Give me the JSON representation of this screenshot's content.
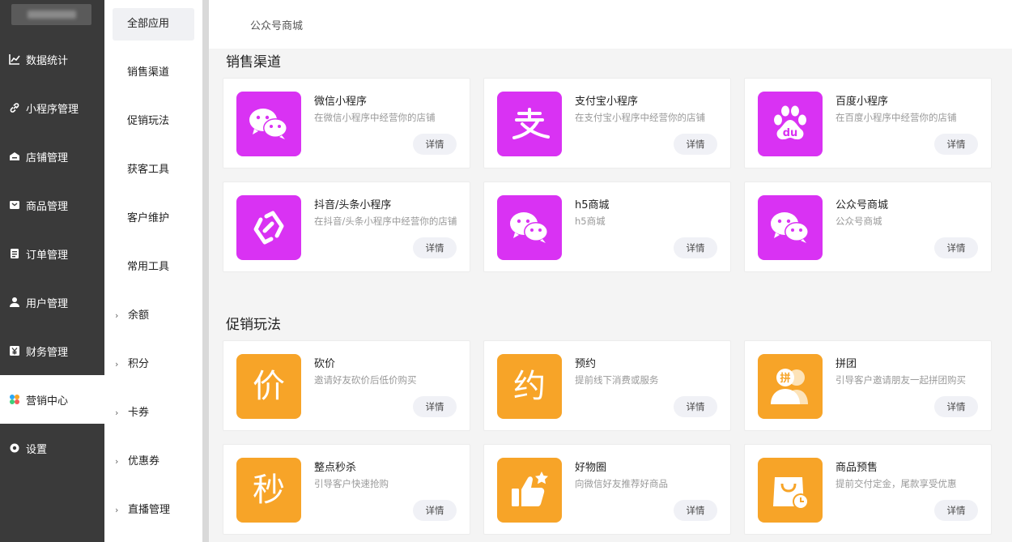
{
  "sidebar": {
    "items": [
      {
        "label": "数据统计",
        "icon": "chart-line-icon"
      },
      {
        "label": "小程序管理",
        "icon": "link-icon"
      },
      {
        "label": "店铺管理",
        "icon": "store-icon"
      },
      {
        "label": "商品管理",
        "icon": "box-icon"
      },
      {
        "label": "订单管理",
        "icon": "clipboard-icon"
      },
      {
        "label": "用户管理",
        "icon": "user-icon"
      },
      {
        "label": "财务管理",
        "icon": "yen-icon"
      },
      {
        "label": "营销中心",
        "icon": "marketing-icon"
      },
      {
        "label": "设置",
        "icon": "gear-icon"
      }
    ]
  },
  "submenu": {
    "items": [
      {
        "label": "全部应用"
      },
      {
        "label": "销售渠道"
      },
      {
        "label": "促销玩法"
      },
      {
        "label": "获客工具"
      },
      {
        "label": "客户维护"
      },
      {
        "label": "常用工具"
      },
      {
        "label": "余额"
      },
      {
        "label": "积分"
      },
      {
        "label": "卡券"
      },
      {
        "label": "优惠券"
      },
      {
        "label": "直播管理"
      }
    ]
  },
  "breadcrumb": "公众号商城",
  "sections": [
    {
      "title": "销售渠道",
      "cards": [
        {
          "title": "微信小程序",
          "desc": "在微信小程序中经营你的店铺",
          "btn": "详情",
          "icon": "wechat-icon",
          "color": "#d932f3"
        },
        {
          "title": "支付宝小程序",
          "desc": "在支付宝小程序中经营你的店铺",
          "btn": "详情",
          "icon": "alipay-icon",
          "color": "#d932f3"
        },
        {
          "title": "百度小程序",
          "desc": "在百度小程序中经营你的店铺",
          "btn": "详情",
          "icon": "baidu-icon",
          "color": "#d932f3"
        },
        {
          "title": "抖音/头条小程序",
          "desc": "在抖音/头条小程序中经营你的店铺",
          "btn": "详情",
          "icon": "douyin-link-icon",
          "color": "#d932f3"
        },
        {
          "title": "h5商城",
          "desc": "h5商城",
          "btn": "详情",
          "icon": "wechat-icon",
          "color": "#d932f3"
        },
        {
          "title": "公众号商城",
          "desc": "公众号商城",
          "btn": "详情",
          "icon": "wechat-icon",
          "color": "#d932f3"
        }
      ]
    },
    {
      "title": "促销玩法",
      "cards": [
        {
          "title": "砍价",
          "desc": "邀请好友砍价后低价购买",
          "btn": "详情",
          "icon": "bargain-icon",
          "glyph": "价",
          "color": "#f7a428"
        },
        {
          "title": "预约",
          "desc": "提前线下消费或服务",
          "btn": "详情",
          "icon": "appointment-icon",
          "glyph": "约",
          "color": "#f7a428"
        },
        {
          "title": "拼团",
          "desc": "引导客户邀请朋友一起拼团购买",
          "btn": "详情",
          "icon": "group-buy-icon",
          "glyph": "拼",
          "color": "#f7a428"
        },
        {
          "title": "整点秒杀",
          "desc": "引导客户快速抢购",
          "btn": "详情",
          "icon": "flash-sale-icon",
          "glyph": "秒",
          "color": "#f7a428"
        },
        {
          "title": "好物圈",
          "desc": "向微信好友推荐好商品",
          "btn": "详情",
          "icon": "thumbs-up-icon",
          "color": "#f7a428"
        },
        {
          "title": "商品预售",
          "desc": "提前交付定金，尾款享受优惠",
          "btn": "详情",
          "icon": "presale-bag-icon",
          "color": "#f7a428"
        }
      ]
    }
  ]
}
